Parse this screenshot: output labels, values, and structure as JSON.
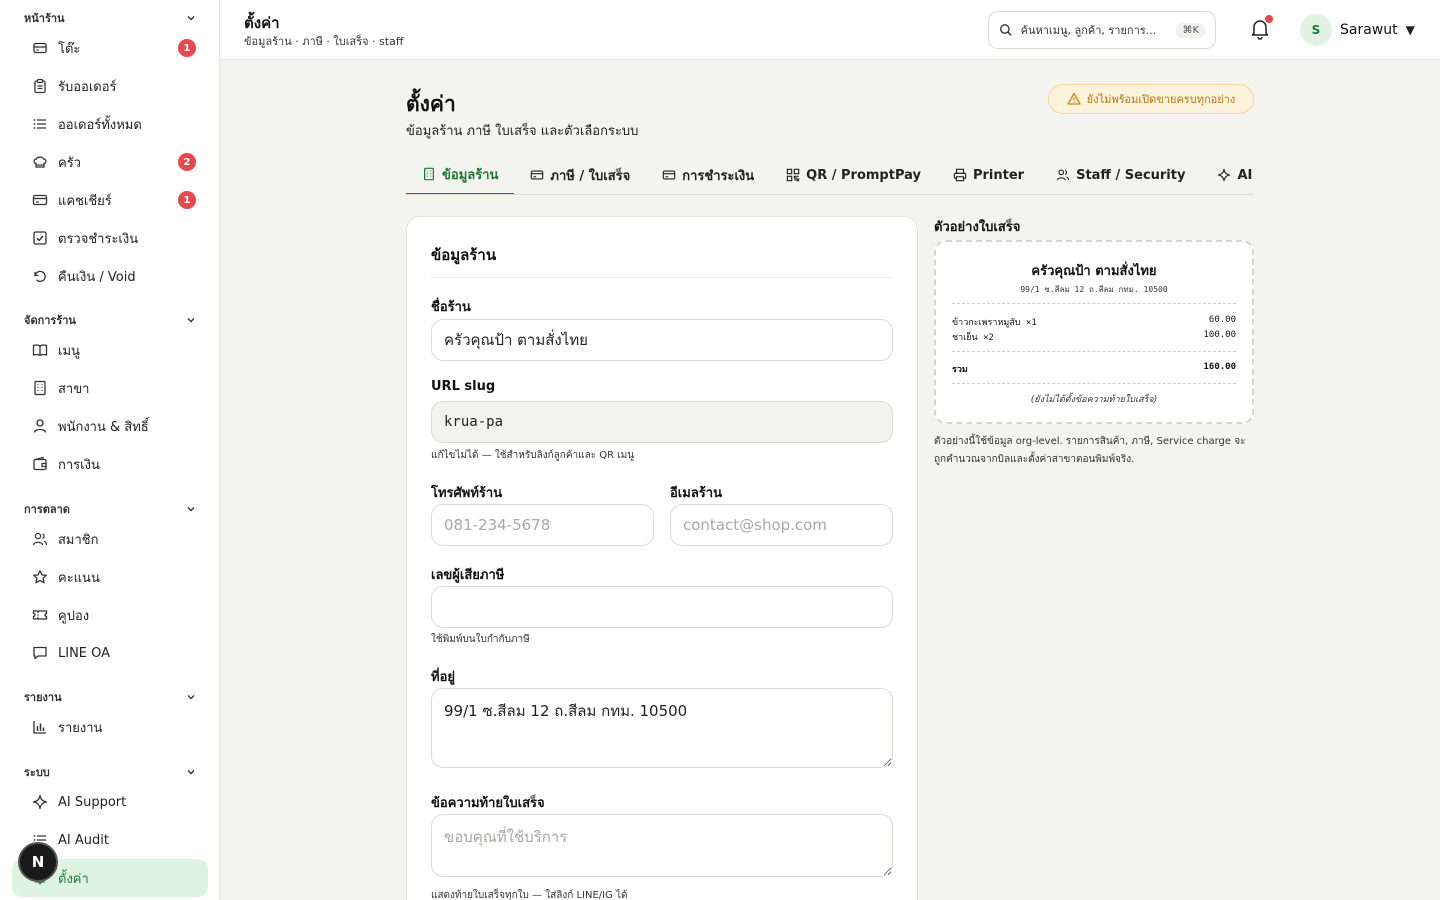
{
  "sidebar": {
    "sections": [
      {
        "title": "หน้าร้าน",
        "items": [
          {
            "label": "โต๊ะ",
            "icon": "table-icon",
            "badge": "1"
          },
          {
            "label": "รับออเดอร์",
            "icon": "clipboard-icon"
          },
          {
            "label": "ออเดอร์ทั้งหมด",
            "icon": "list-icon"
          },
          {
            "label": "ครัว",
            "icon": "chef-hat-icon",
            "badge": "2"
          },
          {
            "label": "แคชเชียร์",
            "icon": "credit-card-icon",
            "badge": "1"
          },
          {
            "label": "ตรวจชำระเงิน",
            "icon": "check-square-icon"
          },
          {
            "label": "คืนเงิน / Void",
            "icon": "undo-icon"
          }
        ]
      },
      {
        "title": "จัดการร้าน",
        "items": [
          {
            "label": "เมนู",
            "icon": "book-icon"
          },
          {
            "label": "สาขา",
            "icon": "building-icon"
          },
          {
            "label": "พนักงาน & สิทธิ์",
            "icon": "user-icon"
          },
          {
            "label": "การเงิน",
            "icon": "wallet-icon"
          }
        ]
      },
      {
        "title": "การตลาด",
        "items": [
          {
            "label": "สมาชิก",
            "icon": "users-icon"
          },
          {
            "label": "คะแนน",
            "icon": "star-icon"
          },
          {
            "label": "คูปอง",
            "icon": "ticket-icon"
          },
          {
            "label": "LINE OA",
            "icon": "chat-icon"
          }
        ]
      },
      {
        "title": "รายงาน",
        "items": [
          {
            "label": "รายงาน",
            "icon": "bar-chart-icon"
          }
        ]
      },
      {
        "title": "ระบบ",
        "items": [
          {
            "label": "AI Support",
            "icon": "sparkle-icon"
          },
          {
            "label": "AI Audit",
            "icon": "list-icon"
          },
          {
            "label": "ตั้งค่า",
            "icon": "gear-icon",
            "active": true
          }
        ]
      }
    ],
    "fab_label": "N"
  },
  "topbar": {
    "title": "ตั้งค่า",
    "subtitle": "ข้อมูลร้าน · ภาษี · ใบเสร็จ · staff",
    "search_placeholder": "ค้นหาเมนู, ลูกค้า, รายการ...",
    "search_shortcut": "⌘K",
    "user_initial": "S",
    "user_name": "Sarawut",
    "caret": "▼"
  },
  "main": {
    "title": "ตั้งค่า",
    "subtitle": "ข้อมูลร้าน ภาษี ใบเสร็จ และตัวเลือกระบบ",
    "warning": "ยังไม่พร้อมเปิดขายครบทุกอย่าง",
    "tabs": [
      {
        "label": "ข้อมูลร้าน",
        "icon": "building-icon",
        "active": true
      },
      {
        "label": "ภาษี / ใบเสร็จ",
        "icon": "receipt-icon"
      },
      {
        "label": "การชำระเงิน",
        "icon": "credit-card-icon"
      },
      {
        "label": "QR / PromptPay",
        "icon": "qr-icon"
      },
      {
        "label": "Printer",
        "icon": "printer-icon"
      },
      {
        "label": "Staff / Security",
        "icon": "users-icon"
      },
      {
        "label": "AI",
        "icon": "sparkle-icon"
      }
    ]
  },
  "form": {
    "title": "ข้อมูลร้าน",
    "shop_name_label": "ชื่อร้าน",
    "shop_name_value": "ครัวคุณป้า ตามสั่งไทย",
    "slug_label": "URL slug",
    "slug_value": "krua-pa",
    "slug_hint": "แก้ไขไม่ได้ — ใช้สำหรับลิงก์ลูกค้าและ QR เมนู",
    "phone_label": "โทรศัพท์ร้าน",
    "phone_placeholder": "081-234-5678",
    "email_label": "อีเมลร้าน",
    "email_placeholder": "contact@shop.com",
    "tax_label": "เลขผู้เสียภาษี",
    "tax_value": "",
    "tax_hint": "ใช้พิมพ์บนใบกำกับภาษี",
    "address_label": "ที่อยู่",
    "address_value": "99/1 ซ.สีลม 12 ถ.สีลม กทม. 10500",
    "footer_label": "ข้อความท้ายใบเสร็จ",
    "footer_placeholder": "ขอบคุณที่ใช้บริการ",
    "footer_hint": "แสดงท้ายใบเสร็จทุกใบ — ใส่ลิงก์ LINE/IG ได้"
  },
  "preview": {
    "title": "ตัวอย่างใบเสร็จ",
    "shop": "ครัวคุณป้า ตามสั่งไทย",
    "address": "99/1 ซ.สีลม 12 ถ.สีลม กทม. 10500",
    "items": [
      {
        "name": "ข้าวกะเพราหมูสับ ×1",
        "amount": "60.00"
      },
      {
        "name": "ชาเย็น ×2",
        "amount": "100.00"
      }
    ],
    "total_label": "รวม",
    "total_value": "160.00",
    "footer_note": "(ยังไม่ได้ตั้งข้อความท้ายใบเสร็จ)",
    "note": "ตัวอย่างนี้ใช้ข้อมูล org-level. รายการสินค้า, ภาษี, Service charge จะถูกคำนวณจากบิลและตั้งค่าสาขาตอนพิมพ์จริง."
  }
}
